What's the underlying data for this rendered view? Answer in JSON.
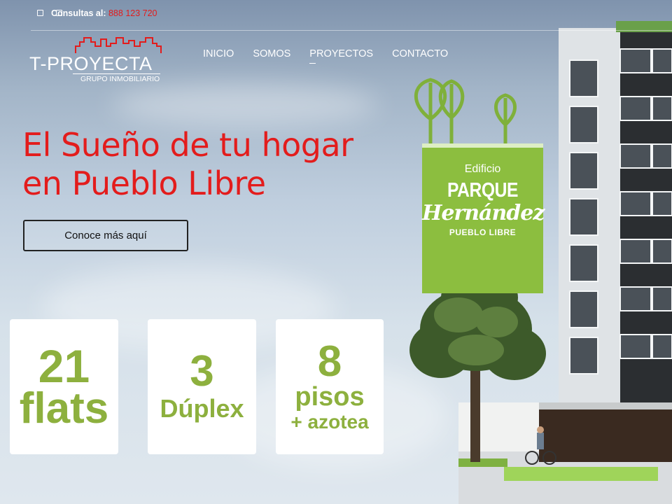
{
  "topbar": {
    "social_icons": [
      "facebook-icon",
      "youtube-icon"
    ],
    "consult_label": "Consultas al:",
    "phone": "888 123 720"
  },
  "logo": {
    "name": "T-PROYECTA",
    "tagline": "GRUPO INMOBILIARIO"
  },
  "nav": {
    "items": [
      {
        "label": "INICIO"
      },
      {
        "label": "SOMOS"
      },
      {
        "label": "PROYECTOS"
      },
      {
        "label": "CONTACTO"
      }
    ]
  },
  "hero": {
    "title_line1": "El Sueño de tu hogar",
    "title_line2": "en Pueblo Libre",
    "cta_label": "Conoce más aquí"
  },
  "stats": [
    {
      "line1": "21",
      "line2": "flats",
      "line3": ""
    },
    {
      "line1": "3",
      "line2": "Dúplex",
      "line3": ""
    },
    {
      "line1": "8",
      "line2": "pisos",
      "line3": "+ azotea"
    }
  ],
  "project_badge": {
    "label": "Edificio",
    "name_line1": "PARQUE",
    "name_line2": "Hernández",
    "location": "PUEBLO LIBRE"
  },
  "colors": {
    "accent_red": "#e31c1c",
    "brand_green": "#8cbe3f",
    "stat_green": "#8db03e"
  }
}
